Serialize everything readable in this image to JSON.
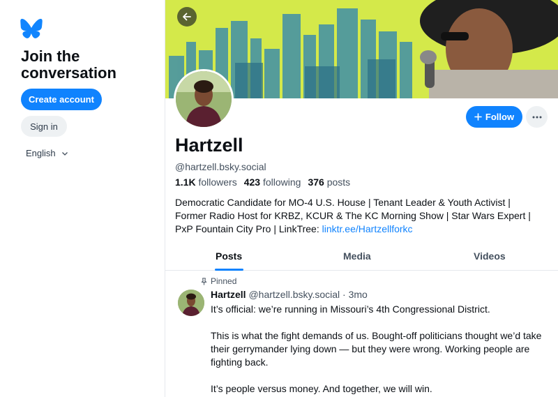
{
  "sidebar": {
    "logo": "butterfly-logo",
    "title": "Join the conversation",
    "create_account": "Create account",
    "sign_in": "Sign in",
    "language": "English"
  },
  "profile": {
    "display_name": "Hartzell",
    "handle": "@hartzell.bsky.social",
    "followers_count": "1.1K",
    "followers_label": "followers",
    "following_count": "423",
    "following_label": "following",
    "posts_count": "376",
    "posts_label": "posts",
    "bio_line1": "Democratic Candidate for MO-4 U.S. House | Tenant Leader & Youth Activist |",
    "bio_line2": "Former Radio Host for KRBZ, KCUR & The KC Morning Show | Star Wars Expert |",
    "bio_line3_text": "PxP Fountain City Pro | LinkTree: ",
    "bio_link": "linktr.ee/Hartzellforkc",
    "follow_label": "Follow",
    "more_icon": "ellipsis-icon"
  },
  "tabs": [
    {
      "label": "Posts",
      "active": true
    },
    {
      "label": "Media",
      "active": false
    },
    {
      "label": "Videos",
      "active": false
    }
  ],
  "post": {
    "pinned_label": "Pinned",
    "author": "Hartzell",
    "handle_time": "@hartzell.bsky.social · 3mo",
    "paragraph1": "It’s official: we’re running in Missouri’s 4th Congressional District.",
    "paragraph2": "This is what the fight demands of us. Bought-off politicians thought we’d take their gerrymander lying down — but they were wrong. Working people are fighting back.",
    "paragraph3": "It’s people versus money. And together, we will win."
  },
  "colors": {
    "accent": "#1083fe",
    "banner": "#c9e33a"
  }
}
